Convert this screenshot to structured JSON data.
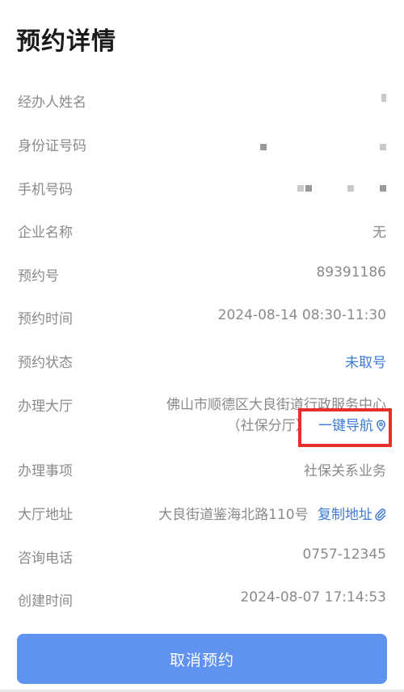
{
  "page": {
    "title": "预约详情"
  },
  "fields": {
    "handler_name": {
      "label": "经办人姓名"
    },
    "id_number": {
      "label": "身份证号码"
    },
    "phone": {
      "label": "手机号码"
    },
    "company": {
      "label": "企业名称",
      "value": "无"
    },
    "booking_no": {
      "label": "预约号",
      "value": "89391186"
    },
    "booking_time": {
      "label": "预约时间",
      "value": "2024-08-14 08:30-11:30"
    },
    "booking_status": {
      "label": "预约状态",
      "value": "未取号",
      "color": "#3d7bd6"
    },
    "hall": {
      "label": "办理大厅",
      "line1": "佛山市顺德区大良街道行政服务中心",
      "line2": "（社保分厅）",
      "nav_label": "一键导航",
      "nav_icon": "location-pin-icon"
    },
    "service": {
      "label": "办理事项",
      "value": "社保关系业务"
    },
    "address": {
      "label": "大厅地址",
      "value": "大良街道鉴海北路110号",
      "copy_label": "复制地址",
      "copy_icon": "paperclip-icon"
    },
    "hotline": {
      "label": "咨询电话",
      "value": "0757-12345"
    },
    "created_time": {
      "label": "创建时间",
      "value": "2024-08-07 17:14:53"
    }
  },
  "actions": {
    "cancel_label": "取消预约",
    "cancel_color": "#5f93ef"
  },
  "colors": {
    "accent": "#3d7bd6",
    "highlight_box": "#e8302a"
  }
}
